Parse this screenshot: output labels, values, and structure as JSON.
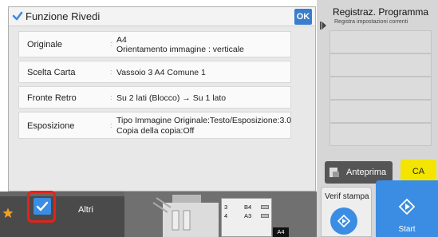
{
  "dialog": {
    "title": "Funzione Rivedi",
    "ok_label": "OK",
    "rows": [
      {
        "label": "Originale",
        "value_lines": [
          "A4",
          "Orientamento immagine : verticale"
        ]
      },
      {
        "label": "Scelta Carta",
        "value_lines": [
          "Vassoio 3  A4  Comune 1"
        ]
      },
      {
        "label": "Fronte Retro",
        "value_lines": [
          "Su 2 lati (Blocco) →  Su 1 lato"
        ]
      },
      {
        "label": "Esposizione",
        "value_lines": [
          "Tipo Immagine Originale:Testo/Esposizione:3.0",
          "Copia della copia:Off"
        ]
      }
    ]
  },
  "program_panel": {
    "title": "Registraz. Programma",
    "subtitle": "Registra impostazioni correnti"
  },
  "buttons": {
    "preview": "Anteprima",
    "ca": "CA",
    "verif": "Verif stampa",
    "start": "Start",
    "altri": "Altri"
  },
  "trays": [
    {
      "number": "3",
      "size": "B4"
    },
    {
      "number": "4",
      "size": "A3"
    }
  ],
  "current_paper": "A4",
  "colors": {
    "accent_blue": "#3b8de3",
    "ca_yellow": "#f3e500",
    "highlight_red": "#e0241d",
    "star_orange": "#f0a020"
  },
  "icons": [
    "check-icon",
    "star-icon",
    "play-diamond-icon",
    "preview-icon",
    "arrow-right-icon"
  ]
}
